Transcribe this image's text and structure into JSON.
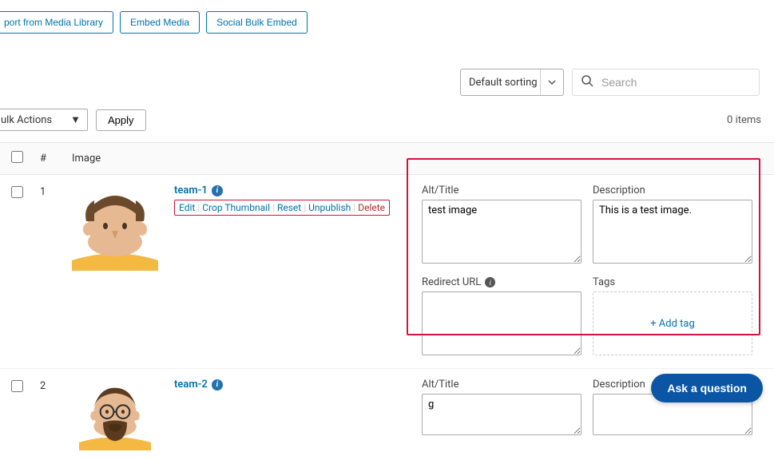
{
  "topButtons": {
    "importLib": "port from Media Library",
    "embed": "Embed Media",
    "socialBulk": "Social Bulk Embed"
  },
  "sort": {
    "default": "Default sorting"
  },
  "search": {
    "placeholder": "Search"
  },
  "bulk": {
    "label": "ulk Actions",
    "apply": "Apply"
  },
  "itemsCount": "0 items",
  "headers": {
    "num": "#",
    "image": "Image"
  },
  "rows": [
    {
      "num": "1",
      "title": "team-1",
      "actions": {
        "edit": "Edit",
        "crop": "Crop Thumbnail",
        "reset": "Reset",
        "unpublish": "Unpublish",
        "delete": "Delete"
      },
      "altTitleLabel": "Alt/Title",
      "altTitle": "test image",
      "descriptionLabel": "Description",
      "description": "This is a test image.",
      "redirectLabel": "Redirect URL",
      "redirect": "",
      "tagsLabel": "Tags",
      "addTag": "+ Add tag"
    },
    {
      "num": "2",
      "title": "team-2",
      "altTitleLabel": "Alt/Title",
      "altTitle": "g",
      "descriptionLabel": "Description",
      "description": ""
    }
  ],
  "ask": "Ask a question"
}
